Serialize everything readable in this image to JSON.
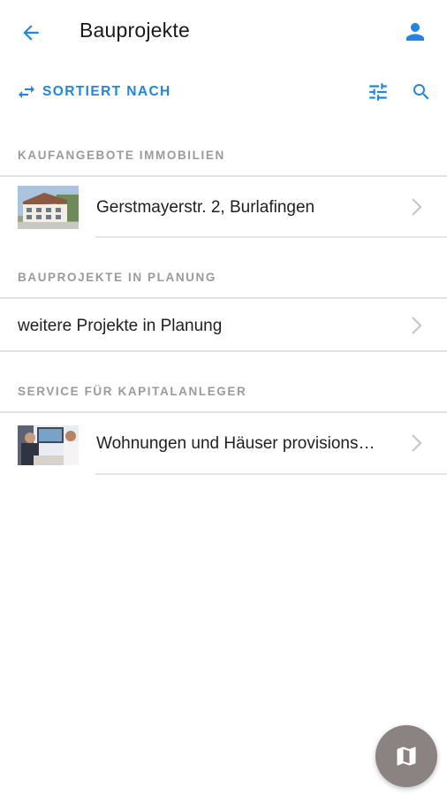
{
  "app": {
    "title": "Bauprojekte",
    "accent_color": "#1f86e8"
  },
  "toolbar": {
    "back_icon": "arrow-left-icon",
    "user_icon": "person-icon",
    "sort_label": "SORTIERT NACH",
    "sort_icon": "swap-arrows-icon",
    "filter_icon": "sliders-icon",
    "search_icon": "search-icon"
  },
  "sections": [
    {
      "header": "KAUFANGEBOTE IMMOBILIEN",
      "items": [
        {
          "label": "Gerstmayerstr. 2, Burlafingen",
          "has_thumbnail": true,
          "thumbnail": "building-photo"
        }
      ]
    },
    {
      "header": "BAUPROJEKTE IN PLANUNG",
      "items": [
        {
          "label": "weitere Projekte in Planung",
          "has_thumbnail": false
        }
      ]
    },
    {
      "header": "SERVICE FÜR KAPITALANLEGER",
      "items": [
        {
          "label": "Wohnungen und Häuser provisions…",
          "has_thumbnail": true,
          "thumbnail": "office-meeting-photo"
        }
      ]
    }
  ],
  "fab": {
    "icon": "map-icon",
    "color": "#8a8381"
  }
}
